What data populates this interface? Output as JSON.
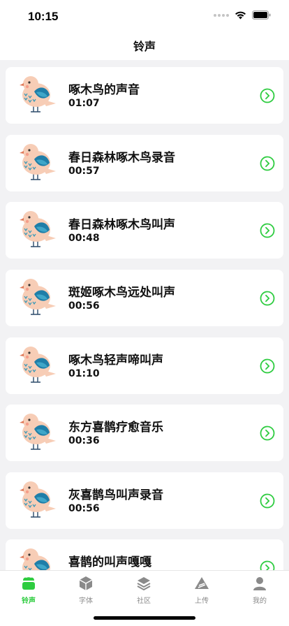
{
  "status_bar": {
    "time": "10:15"
  },
  "nav": {
    "title": "铃声"
  },
  "ringtones": [
    {
      "title": "啄木鸟的声音",
      "duration": "01:07"
    },
    {
      "title": "春日森林啄木鸟录音",
      "duration": "00:57"
    },
    {
      "title": "春日森林啄木鸟叫声",
      "duration": "00:48"
    },
    {
      "title": "斑姬啄木鸟远处叫声",
      "duration": "00:56"
    },
    {
      "title": "啄木鸟轻声啼叫声",
      "duration": "01:10"
    },
    {
      "title": "东方喜鹊疗愈音乐",
      "duration": "00:36"
    },
    {
      "title": "灰喜鹊鸟叫声录音",
      "duration": "00:56"
    },
    {
      "title": "喜鹊的叫声嘎嘎",
      "duration": ""
    }
  ],
  "tabs": [
    {
      "label": "铃声",
      "icon": "ringtone-icon",
      "active": true
    },
    {
      "label": "字体",
      "icon": "font-box-icon",
      "active": false
    },
    {
      "label": "社区",
      "icon": "layers-icon",
      "active": false
    },
    {
      "label": "上传",
      "icon": "upload-icon",
      "active": false
    },
    {
      "label": "我的",
      "icon": "person-icon",
      "active": false
    }
  ],
  "colors": {
    "accent": "#2ecc40",
    "inactive": "#8a8a8a",
    "background": "#f2f2f4"
  }
}
